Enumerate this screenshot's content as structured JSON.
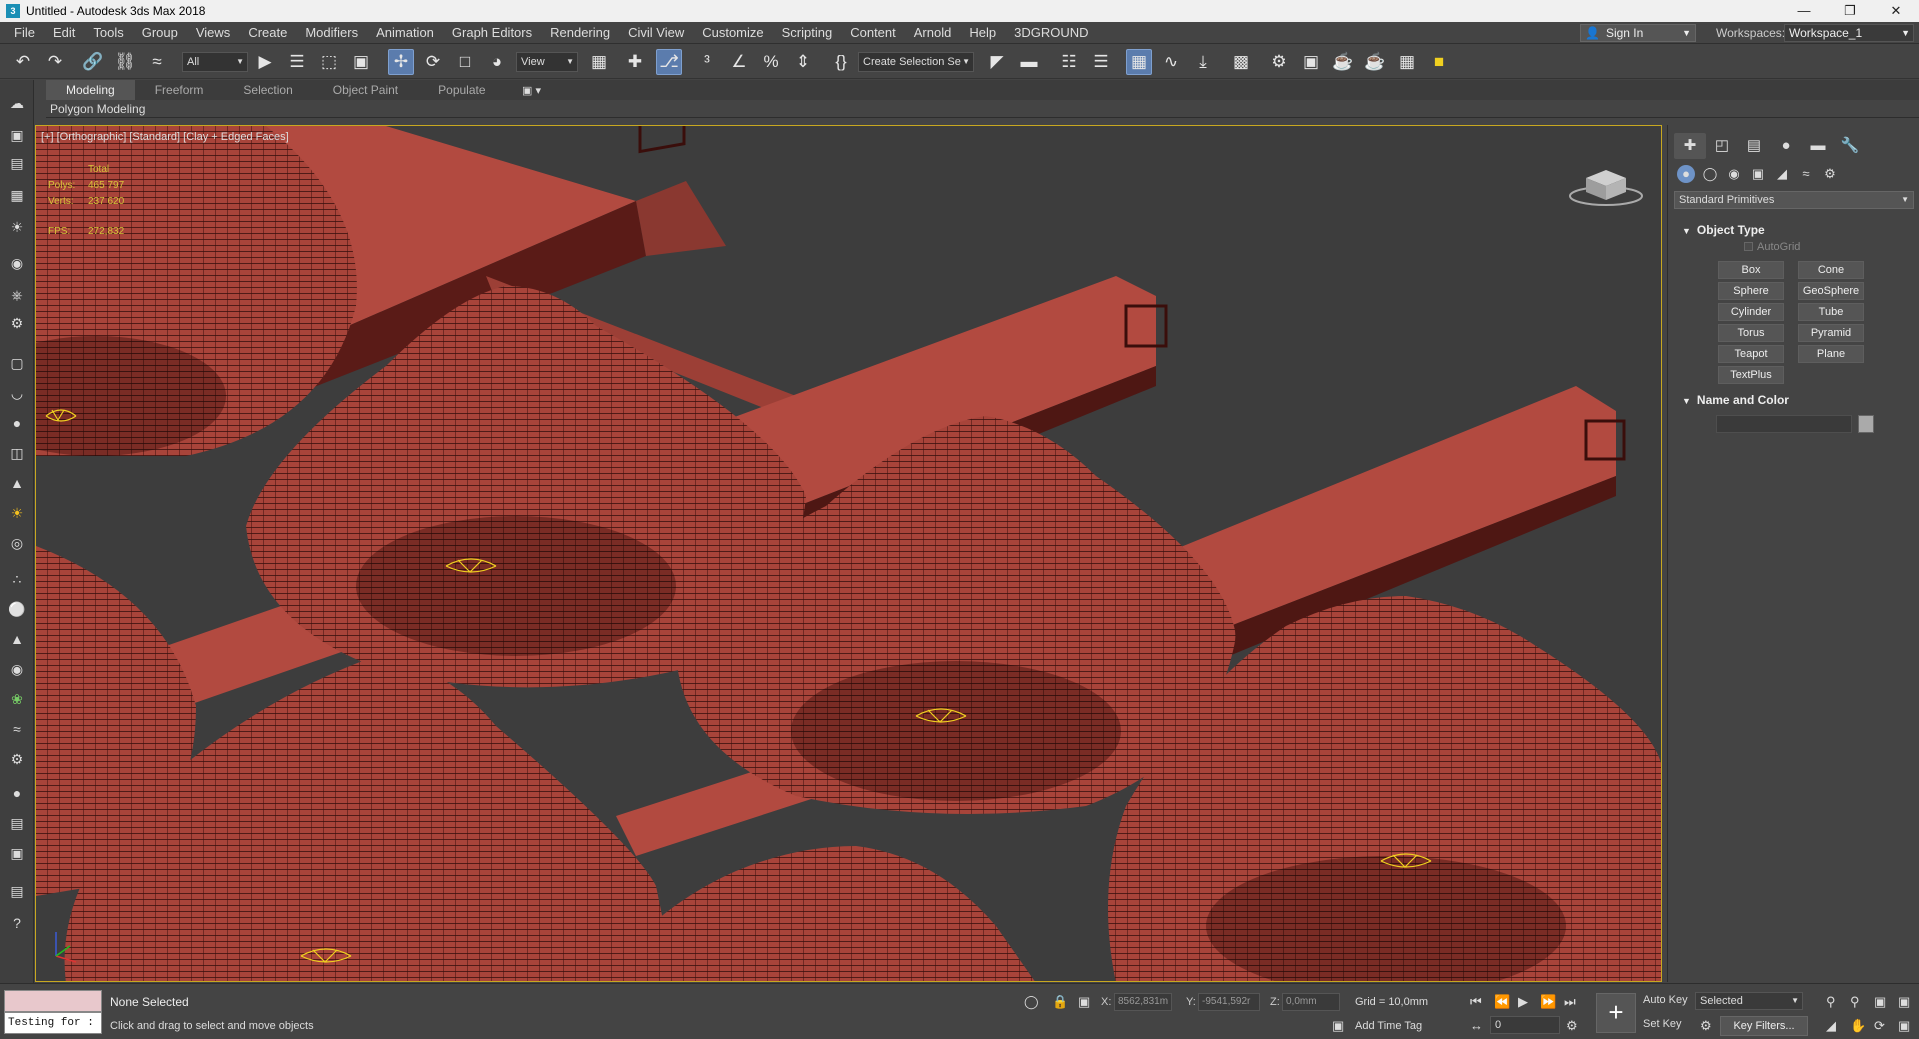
{
  "window": {
    "title": "Untitled - Autodesk 3ds Max 2018"
  },
  "menu": [
    "File",
    "Edit",
    "Tools",
    "Group",
    "Views",
    "Create",
    "Modifiers",
    "Animation",
    "Graph Editors",
    "Rendering",
    "Civil View",
    "Customize",
    "Scripting",
    "Content",
    "Arnold",
    "Help",
    "3DGROUND"
  ],
  "account": {
    "sign_in": "Sign In",
    "workspaces_label": "Workspaces:",
    "workspace": "Workspace_1"
  },
  "toolbar": {
    "filter": "All",
    "ref_coord": "View",
    "selection_set": "Create Selection Se"
  },
  "ribbon": {
    "tabs": [
      "Modeling",
      "Freeform",
      "Selection",
      "Object Paint",
      "Populate"
    ],
    "active_tab": "Modeling",
    "panel": "Polygon Modeling"
  },
  "viewport": {
    "label": "[+] [Orthographic] [Standard] [Clay + Edged Faces]",
    "stats": {
      "total_label": "Total",
      "polys_label": "Polys:",
      "polys": "465 797",
      "verts_label": "Verts:",
      "verts": "237 620",
      "fps_label": "FPS:",
      "fps": "272,832"
    },
    "colors": {
      "object": "#a8443a",
      "object_dark": "#5c1d18",
      "wire": "#2a0907",
      "border": "#c8a820",
      "background": "#3d3d3d"
    }
  },
  "command_panel": {
    "category": "Standard Primitives",
    "object_type_title": "Object Type",
    "autogrid": "AutoGrid",
    "primitives": [
      "Box",
      "Cone",
      "Sphere",
      "GeoSphere",
      "Cylinder",
      "Tube",
      "Torus",
      "Pyramid",
      "Teapot",
      "Plane",
      "TextPlus"
    ],
    "name_color_title": "Name and Color"
  },
  "status": {
    "maxscript_text": "Testing for :",
    "selection": "None Selected",
    "prompt": "Click and drag to select and move objects",
    "x_label": "X:",
    "x": "8562,831m",
    "y_label": "Y:",
    "y": "-9541,592r",
    "z_label": "Z:",
    "z": "0,0mm",
    "grid": "Grid = 10,0mm",
    "add_time_tag": "Add Time Tag",
    "frame": "0",
    "auto_key": "Auto Key",
    "set_key": "Set Key",
    "selected_set": "Selected",
    "key_filters": "Key Filters..."
  }
}
